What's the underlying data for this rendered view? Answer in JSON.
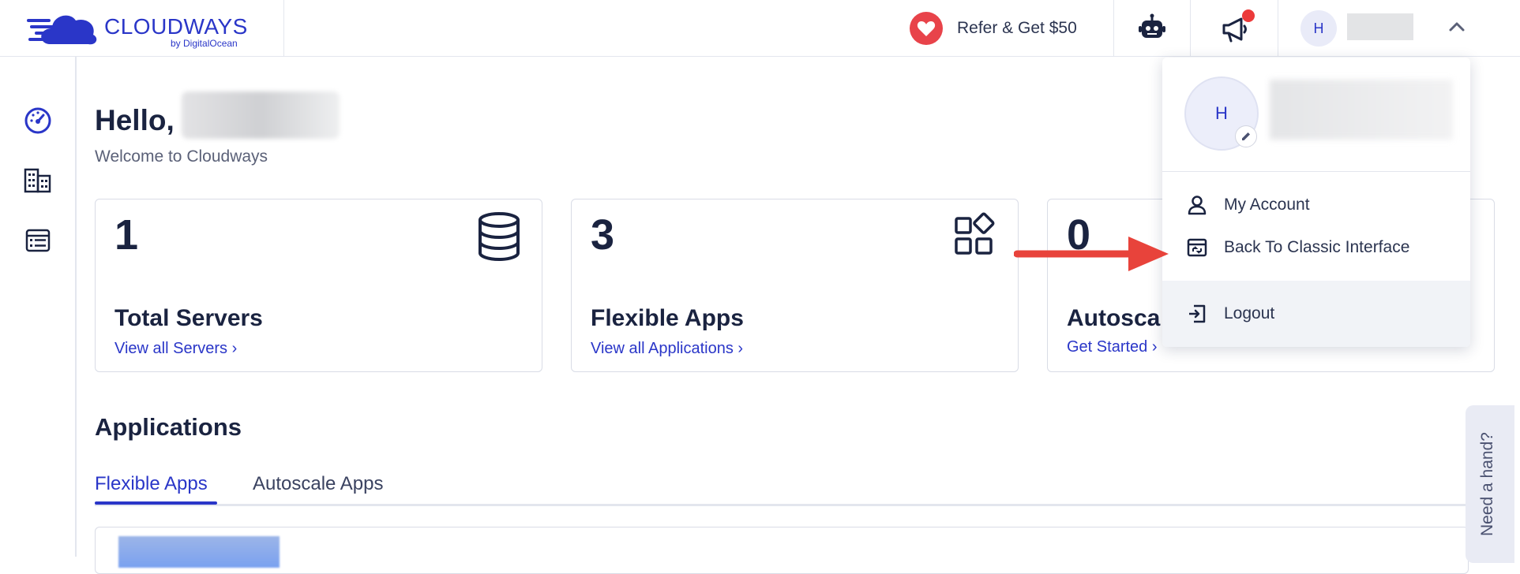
{
  "brand": {
    "name": "CLOUDWAYS",
    "sub": "by DigitalOcean",
    "color": "#2a36c8"
  },
  "topbar": {
    "refer_label": "Refer & Get $50",
    "avatar_initial": "H",
    "notification_dot_color": "#ec3a3a"
  },
  "sidebar": {
    "items": [
      {
        "icon": "dashboard-icon"
      },
      {
        "icon": "servers-icon"
      },
      {
        "icon": "applications-icon"
      }
    ]
  },
  "main": {
    "hello": "Hello,",
    "welcome": "Welcome to Cloudways",
    "cards": [
      {
        "value": "1",
        "title": "Total Servers",
        "link": "View all Servers ›",
        "icon": "database-icon"
      },
      {
        "value": "3",
        "title": "Flexible Apps",
        "link": "View all Applications ›",
        "icon": "apps-grid-icon"
      },
      {
        "value": "0",
        "title": "Autosca",
        "link": "Get Started ›",
        "icon": "autoscale-icon"
      }
    ],
    "applications_title": "Applications",
    "tabs": [
      {
        "label": "Flexible Apps",
        "active": true
      },
      {
        "label": "Autoscale Apps",
        "active": false
      }
    ]
  },
  "help": {
    "label": "Need a hand?"
  },
  "dropdown": {
    "avatar_initial": "H",
    "items": [
      {
        "label": "My Account",
        "icon": "user-icon"
      },
      {
        "label": "Back To Classic Interface",
        "icon": "classic-interface-icon"
      },
      {
        "label": "Logout",
        "icon": "logout-icon"
      }
    ]
  },
  "annotation": {
    "arrow_color": "#e8433b"
  }
}
